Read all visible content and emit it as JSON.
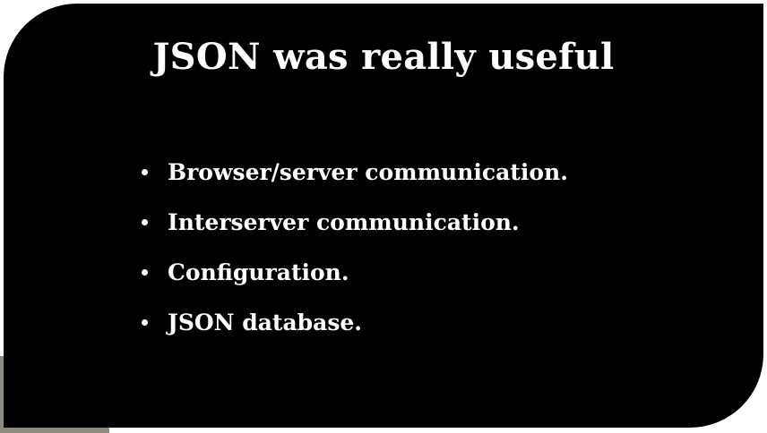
{
  "slide": {
    "title": "JSON was really useful",
    "bullets": [
      "Browser/server communication.",
      "Interserver communication.",
      "Configuration.",
      "JSON database."
    ]
  },
  "colors": {
    "slide_background": "#000000",
    "text": "#ffffff",
    "page_background": "#ffffff",
    "corner_patch": "#8f8a80"
  }
}
